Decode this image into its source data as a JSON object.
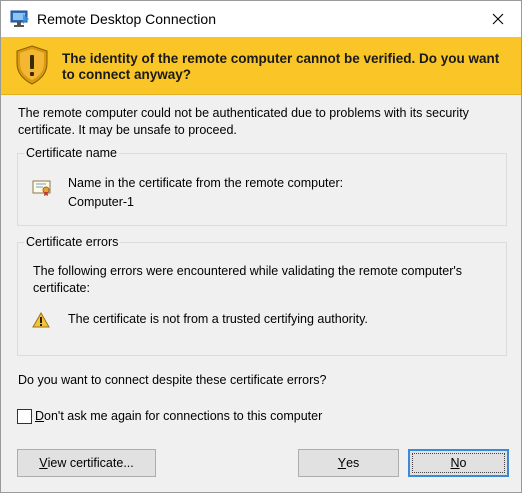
{
  "window": {
    "title": "Remote Desktop Connection",
    "icons": {
      "app": "remote-desktop-icon",
      "close": "close-icon"
    }
  },
  "banner": {
    "icon": "warning-shield-icon",
    "text": "The identity of the remote computer cannot be verified. Do you want to connect anyway?",
    "color": "#f9c527"
  },
  "intro_text": "The remote computer could not be authenticated due to problems with its security certificate. It may be unsafe to proceed.",
  "certificate_name": {
    "legend": "Certificate name",
    "icon": "certificate-icon",
    "label": "Name in the certificate from the remote computer:",
    "value": "Computer-1"
  },
  "certificate_errors": {
    "legend": "Certificate errors",
    "intro": "The following errors were encountered while validating the remote computer's certificate:",
    "icon": "warning-icon",
    "errors": [
      "The certificate is not from a trusted certifying authority."
    ]
  },
  "question": "Do you want to connect despite these certificate errors?",
  "dont_ask": {
    "label_first": "D",
    "label_rest": "on't ask me again for connections to this computer",
    "checked": false
  },
  "buttons": {
    "view": {
      "first": "V",
      "rest": "iew certificate..."
    },
    "yes": {
      "first": "Y",
      "rest": "es"
    },
    "no": {
      "first": "N",
      "rest": "o"
    }
  },
  "colors": {
    "focus": "#3c8ad6",
    "button": "#e1e1e1"
  }
}
